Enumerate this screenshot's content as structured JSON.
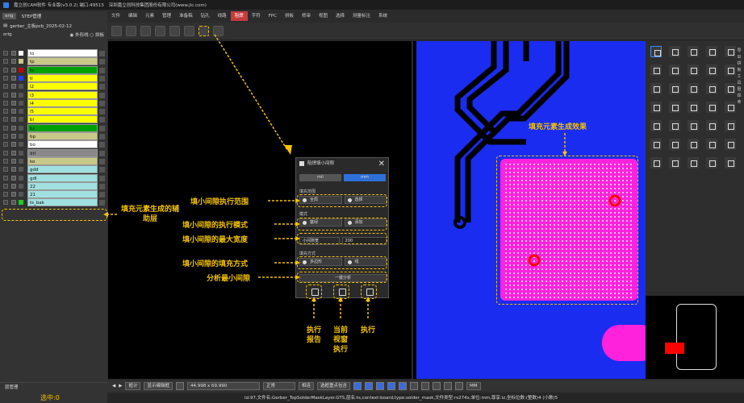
{
  "title": "嘉立创CAM软件 专业版(v3.0.2) 端口:49513",
  "company": "深圳嘉立创科技集团股份有限公司(www.jlc.com)",
  "menu": [
    "文件",
    "编辑",
    "元素",
    "管理",
    "准备稿",
    "钻孔",
    "线路",
    "阻焊",
    "字符",
    "FPC",
    "拼板",
    "修审",
    "视图",
    "选择",
    "测量标注",
    "系统"
  ],
  "menu_active": "阻焊",
  "left": {
    "tabs": [
      "orig",
      "STEP管理"
    ],
    "gerber": "gerber_主板pcb_2025-02-12",
    "orig": "orig",
    "outline": "外形线",
    "panel": "拼板",
    "layers": [
      {
        "name": "to",
        "color": "#ffffff",
        "swatch": "#ffffff"
      },
      {
        "name": "tp",
        "color": "#c8c888",
        "swatch": "#c8c888"
      },
      {
        "name": "ts",
        "color": "#00a000",
        "swatch": "#cc0000"
      },
      {
        "name": "tl",
        "color": "#ffff00",
        "swatch": "#2040ff"
      },
      {
        "name": "l2",
        "color": "#ffff00",
        "swatch": "#555555"
      },
      {
        "name": "l3",
        "color": "#ffff00",
        "swatch": "#555555"
      },
      {
        "name": "l4",
        "color": "#ffff00",
        "swatch": "#555555"
      },
      {
        "name": "l5",
        "color": "#ffff00",
        "swatch": "#555555"
      },
      {
        "name": "bl",
        "color": "#ffff00",
        "swatch": "#555555"
      },
      {
        "name": "bs",
        "color": "#00a000",
        "swatch": "#555555"
      },
      {
        "name": "bp",
        "color": "#c8c888",
        "swatch": "#555555"
      },
      {
        "name": "bo",
        "color": "#ffffff",
        "swatch": "#555555"
      },
      {
        "name": "drl",
        "color": "#888888",
        "swatch": "#555555"
      },
      {
        "name": "ko",
        "color": "#c8c888",
        "swatch": "#555555"
      },
      {
        "name": "gdd",
        "color": "#a0e0e0",
        "swatch": "#555555"
      },
      {
        "name": "gdl",
        "color": "#a0e0e0",
        "swatch": "#555555"
      },
      {
        "name": "22",
        "color": "#a0e0e0",
        "swatch": "#555555"
      },
      {
        "name": "21",
        "color": "#a0e0e0",
        "swatch": "#555555"
      },
      {
        "name": "ts_bak",
        "color": "#a0e0e0",
        "swatch": "#22cc22"
      }
    ],
    "layer_manager": "层管理",
    "selected": "选中:0"
  },
  "dialog": {
    "title": "阻焊填小间隙",
    "units": [
      "mil",
      "mm"
    ],
    "unit_selected": "mm",
    "range_label": "填充范围",
    "range_opts": [
      "全局",
      "选择"
    ],
    "mode_label": "模式",
    "mode_opts": [
      "塞绿",
      "添加"
    ],
    "gap_label": "小间隙宽",
    "gap_value": "200",
    "fill_label": "填充方式",
    "fill_opts": [
      "多边形",
      "线"
    ],
    "analyze": "一键分析"
  },
  "annotations": {
    "range": "填小间隙执行范围",
    "mode": "填小间隙的执行模式",
    "width": "填小间隙的最大宽度",
    "method": "填小间隙的填充方式",
    "analyze": "分析最小间隙",
    "aux": "填充元素生成的辅助层",
    "effect": "填充元素生成效果",
    "report": "执行报告",
    "view": "当前视窗执行",
    "exec": "执行"
  },
  "bottom": {
    "mode": "框计",
    "display": "显示编辑框",
    "coord": "44.998 x 69.990",
    "normal": "正常",
    "hint": "相连",
    "select": "选框重点包含",
    "unit": "MM"
  },
  "status": "id:97,文件名:Gerber_TopSolderMaskLayer.GTS,层名:ts,context:board,type:solder_mask,文件类型:rs274x,单位:mm,尊享:lz,坐标位数:(整数)4 (小数)5",
  "right_side": [
    "导",
    "出",
    "拼",
    "板",
    "工",
    "具",
    "阻",
    "焊",
    "命"
  ]
}
